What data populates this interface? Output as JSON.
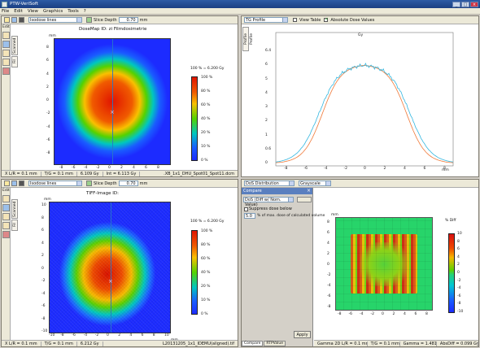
{
  "app": {
    "title": "PTW-VeriSoft"
  },
  "menu": [
    "File",
    "Edit",
    "View",
    "Graphics",
    "Tools",
    "?"
  ],
  "top_left": {
    "combo": "Isodose lines",
    "slice_label": "Slice Depth",
    "slice_value": "0.70",
    "slice_unit": "mm",
    "edit_tab": "Edit",
    "vtabs": [
      "Scanned",
      "Fil"
    ],
    "title": "DoseMap ID: zi Filmdosimetrie",
    "mm": "mm",
    "ticks": [
      "8",
      "6",
      "4",
      "2",
      "0",
      "-2",
      "-4",
      "-6",
      "-8"
    ],
    "xticks": [
      "-8",
      "-6",
      "-4",
      "-2",
      "0",
      "2",
      "4",
      "6",
      "8"
    ],
    "legend_title": "100 % = 6.200 Gy",
    "legend": [
      "100 %",
      "80 %",
      "60 %",
      "40 %",
      "20 %",
      "10 %",
      "0 %"
    ],
    "status": [
      "X   L/R = 0.1 mm",
      "T/G = 0.1 mm",
      "6.109 Gy",
      "Int = 6.113 Gy",
      ".XB_1x1_DHU_Spot01_Spot11.dcm"
    ]
  },
  "top_right": {
    "combo": "TG Profile",
    "view_table": "View Table",
    "abs_dose": "Absolute Dose Values",
    "vtab": "Profile Profile",
    "yunit": "Gy",
    "yticks": [
      "6.4",
      "6",
      "5",
      "4",
      "3",
      "2",
      "1",
      "0.6",
      "0"
    ],
    "xticks": [
      "-8",
      "-6",
      "-4",
      "-2",
      "0",
      "2",
      "4",
      "6",
      "8"
    ],
    "xunit": "mm",
    "colors": {
      "film": "#33b7e0",
      "calc": "#f07a3a"
    }
  },
  "bottom_left": {
    "combo": "Isodose lines",
    "slice_label": "Slice Depth",
    "slice_value": "0.70",
    "slice_unit": "mm",
    "edit_tab": "Edit",
    "vtabs": [
      "Scanned",
      "Fil"
    ],
    "title": "TIFF-Image ID:",
    "mm": "mm",
    "ticks": [
      "10",
      "8",
      "6",
      "4",
      "2",
      "0",
      "-2",
      "-4",
      "-6",
      "-8",
      "-10"
    ],
    "xticks": [
      "-10",
      "-8",
      "-6",
      "-4",
      "-2",
      "0",
      "2",
      "4",
      "6",
      "8",
      "10"
    ],
    "legend_title": "100 % = 6.200 Gy",
    "legend": [
      "100 %",
      "80 %",
      "60 %",
      "40 %",
      "20 %",
      "10 %",
      "0 %"
    ],
    "status": [
      "X   L/R = 0.1 mm",
      "T/G = 0.1 mm",
      "6.212 Gy",
      "L20131205_1x1_IDEMU(aligned).tif"
    ]
  },
  "compare": {
    "combo": "DoS Distribution",
    "combo2": "Grayscale",
    "header": "Compare",
    "mode": "DoS (Diff w/ Nom. Value)",
    "suppress": "Suppress dose below",
    "suppress_value": "5.0",
    "suppress_text": "% of max. dose of calculated volume",
    "apply": "Apply",
    "tabs": [
      "Compare",
      "RTPValue"
    ],
    "legend_title": "% Diff",
    "legend": [
      "10",
      "8",
      "6",
      "4",
      "2",
      "0",
      "-2",
      "-4",
      "-6",
      "-8",
      "-10"
    ],
    "mm": "mm",
    "yticks": [
      "8",
      "6",
      "4",
      "2",
      "0",
      "-2",
      "-4",
      "-6",
      "-8"
    ],
    "xticks": [
      "-8",
      "-6",
      "-4",
      "-2",
      "0",
      "2",
      "4",
      "6",
      "8"
    ],
    "status": [
      "Gamma 2D  L/R = 0.1 mm",
      "T/G = 0.1 mm",
      "Gamma = 1.481",
      "AbsDiff = 0.099 Gy"
    ]
  }
}
